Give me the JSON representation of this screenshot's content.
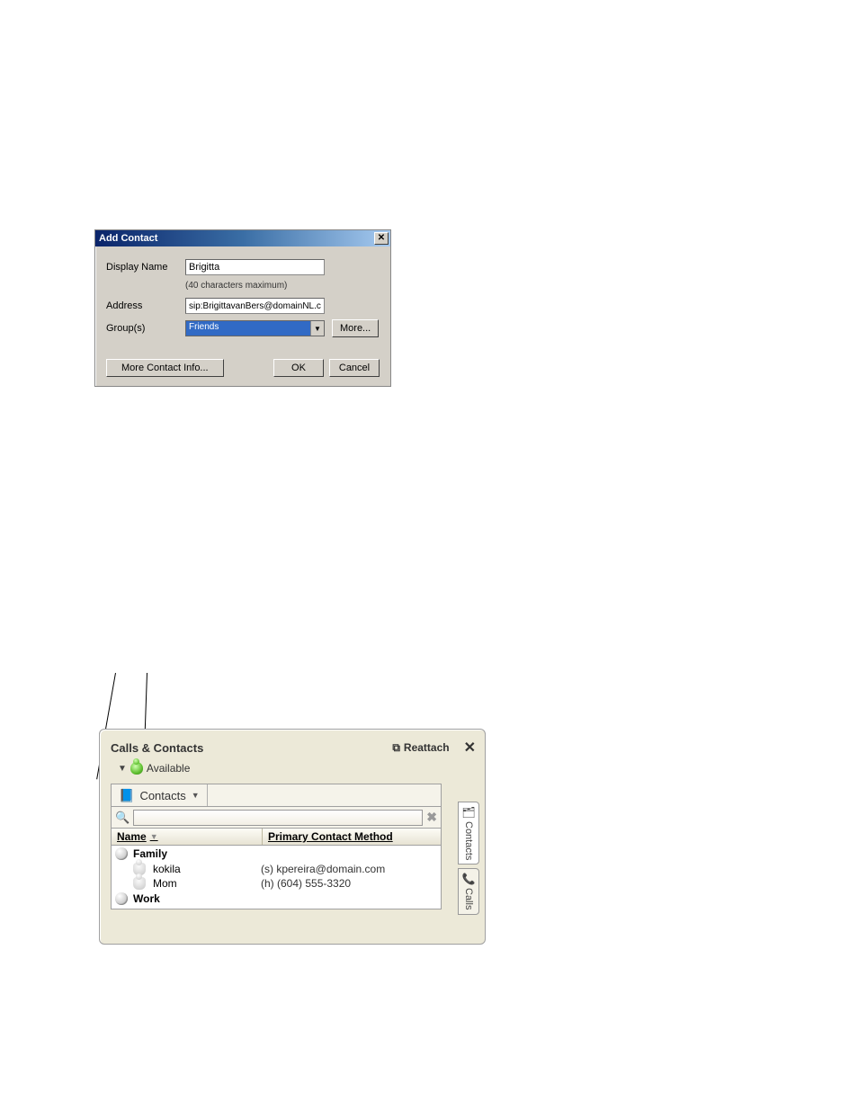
{
  "dialog": {
    "title": "Add Contact",
    "labels": {
      "display_name": "Display Name",
      "address": "Address",
      "groups": "Group(s)"
    },
    "values": {
      "display_name": "Brigitta",
      "address": "sip:BrigittavanBers@domainNL.com",
      "group_selected": "Friends"
    },
    "hint": "(40 characters maximum)",
    "buttons": {
      "more": "More...",
      "more_info": "More Contact Info...",
      "ok": "OK",
      "cancel": "Cancel"
    }
  },
  "panel": {
    "title": "Calls & Contacts",
    "reattach": "Reattach",
    "presence": "Available",
    "toolbar": {
      "contacts": "Contacts"
    },
    "tabs": {
      "contacts": "Contacts",
      "calls": "Calls"
    },
    "columns": {
      "name": "Name",
      "method": "Primary Contact Method"
    },
    "groups": [
      {
        "name": "Family",
        "contacts": [
          {
            "name": "kokila",
            "method": "(s) kpereira@domain.com"
          },
          {
            "name": "Mom",
            "method": "(h) (604) 555-3320"
          }
        ]
      },
      {
        "name": "Work",
        "contacts": []
      }
    ]
  }
}
